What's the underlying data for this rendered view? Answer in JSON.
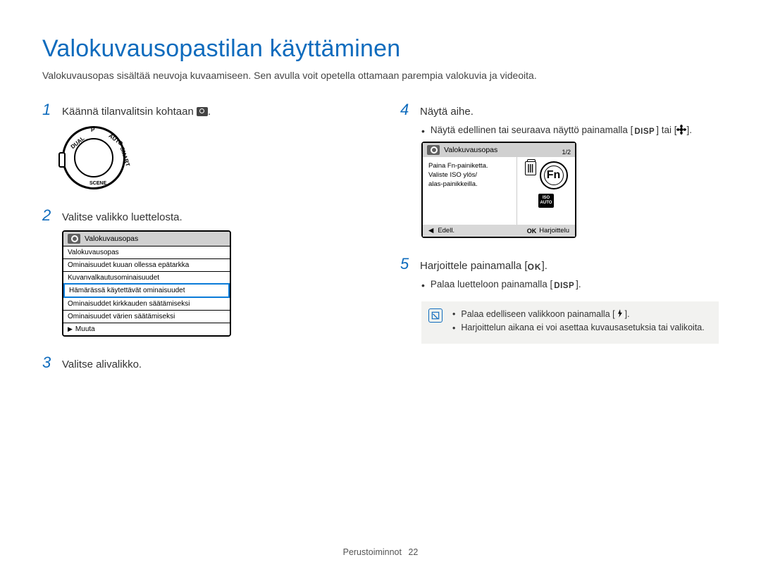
{
  "title": "Valokuvausopastilan käyttäminen",
  "intro": "Valokuvausopas sisältää neuvoja kuvaamiseen. Sen avulla voit opetella ottamaan parempia valokuvia ja videoita.",
  "steps": {
    "s1": {
      "num": "1",
      "text": "Käännä tilanvalitsin kohtaan "
    },
    "s2": {
      "num": "2",
      "text": "Valitse valikko luettelosta."
    },
    "s3": {
      "num": "3",
      "text": "Valitse alivalikko."
    },
    "s4": {
      "num": "4",
      "text": "Näytä aihe."
    },
    "s5": {
      "num": "5",
      "text_pre": "Harjoittele painamalla [",
      "text_post": "]."
    }
  },
  "bullets": {
    "b4": {
      "pre": "Näytä edellinen tai seuraava näyttö painamalla [",
      "mid": "] tai [",
      "post": "]."
    },
    "b5": {
      "pre": "Palaa luetteloon painamalla [",
      "post": "]."
    }
  },
  "dial": {
    "labels": [
      "P",
      "AUTO",
      "SMART",
      "SCENE",
      "",
      "DUAL"
    ]
  },
  "menu": {
    "header": "Valokuvausopas",
    "rows": [
      "Valokuvausopas",
      "Ominaisuudet kuuan ollessa epätarkka",
      "Kuvanvalkautusominaisuudet",
      "Hämärässä käytettävät ominaisuudet",
      "Ominaisuddet kirkkauden säätämiseksi",
      "Ominaisuudet värien säätämiseksi"
    ],
    "selected_index": 3,
    "footer": "Muuta"
  },
  "screen": {
    "header": "Valokuvausopas",
    "page": "1/2",
    "body_lines": [
      "Paina Fn-painiketta.",
      "Valiste ISO ylös/",
      "alas-painikkeilla."
    ],
    "fn": "Fn",
    "iso": [
      "ISO",
      "AUTO"
    ],
    "footer_left": "Edell.",
    "footer_ok": "OK",
    "footer_right": "Harjoittelu"
  },
  "labels": {
    "disp": "DISP",
    "ok": "OK"
  },
  "notes": {
    "n1_pre": "Palaa edelliseen valikkoon painamalla [",
    "n1_post": "].",
    "n2": "Harjoittelun aikana ei voi asettaa kuvausasetuksia tai valikoita."
  },
  "footer": {
    "label": "Perustoiminnot",
    "page": "22"
  }
}
